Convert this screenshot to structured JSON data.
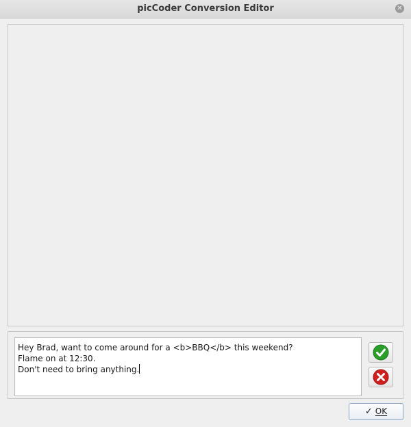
{
  "window": {
    "title": "picCoder Conversion Editor",
    "close_icon": "close-icon"
  },
  "editor": {
    "lines": [
      "Hey Brad, want to come around for a <b>BBQ</b> this weekend?",
      "Flame on at 12:30.",
      "Don't need to bring anything."
    ]
  },
  "actions": {
    "accept_icon": "check-circle-icon",
    "accept_color": "#2a9d2a",
    "reject_icon": "x-circle-icon",
    "reject_color": "#d01f1f"
  },
  "footer": {
    "ok_label": "OK",
    "ok_icon": "checkmark-icon"
  }
}
